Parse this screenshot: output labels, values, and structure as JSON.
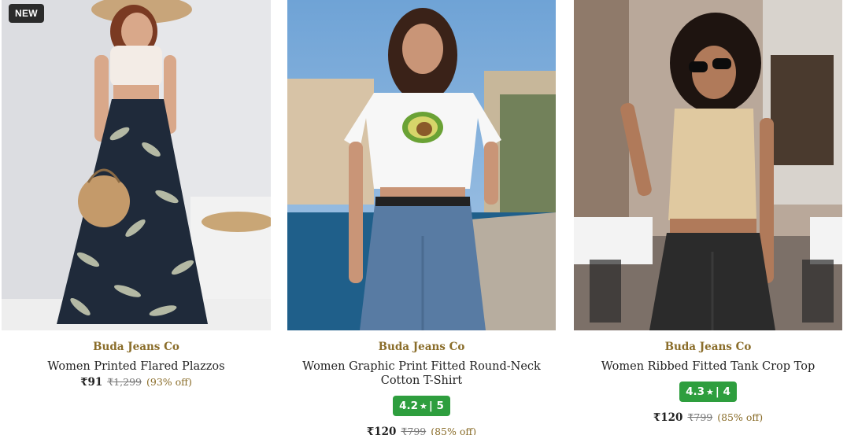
{
  "products": [
    {
      "badge": "NEW",
      "brand": "Buda Jeans Co",
      "title": "Women Printed Flared Plazzos",
      "price": "₹91",
      "mrp": "₹1,299",
      "discount": "(93% off)"
    },
    {
      "brand": "Buda Jeans Co",
      "title": "Women Graphic Print Fitted Round-Neck Cotton T-Shirt",
      "rating_value": "4.2",
      "rating_count": "5",
      "price": "₹120",
      "mrp": "₹799",
      "discount": "(85% off)"
    },
    {
      "brand": "Buda Jeans Co",
      "title": "Women Ribbed Fitted Tank Crop Top",
      "rating_value": "4.3",
      "rating_count": "4",
      "price": "₹120",
      "mrp": "₹799",
      "discount": "(85% off)"
    }
  ],
  "colors": {
    "brand_text": "#8a6d2a",
    "rating_badge": "#2e9e3e",
    "new_badge": "#2b2b2b"
  }
}
